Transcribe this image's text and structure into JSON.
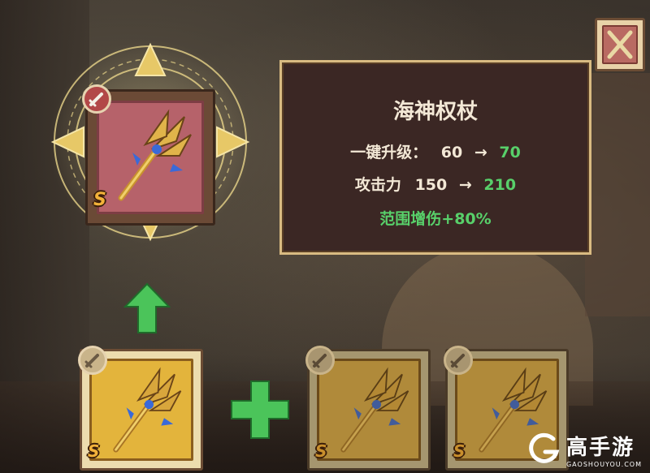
{
  "item": {
    "name": "海神权杖",
    "grade": "S"
  },
  "panel": {
    "title": "海神权杖",
    "upgrade_label": "一键升级：",
    "upgrade_from": "60",
    "upgrade_arrow": "→",
    "upgrade_to": "70",
    "attack_label": "攻击力",
    "attack_from": "150",
    "attack_arrow": "→",
    "attack_to": "210",
    "bonus": "范围增伤+80%"
  },
  "materials": {
    "plus_symbol": "+",
    "slots": [
      {
        "grade": "S"
      },
      {
        "grade": "S"
      },
      {
        "grade": "S"
      }
    ]
  },
  "watermark": {
    "brand": "高手游",
    "url": "GAOSHOUYOU.COM"
  },
  "colors": {
    "panel_bg": "#3b2724",
    "panel_border": "#d9bb82",
    "green_value": "#58d06a",
    "gold_frame": "#e3b43c",
    "red_slot": "#b6626a",
    "close_button": "#b96a62"
  },
  "icons": [
    "sword-icon",
    "trident-icon",
    "arrow-up-icon",
    "plus-icon",
    "close-icon",
    "triangle-arrow-icon"
  ]
}
